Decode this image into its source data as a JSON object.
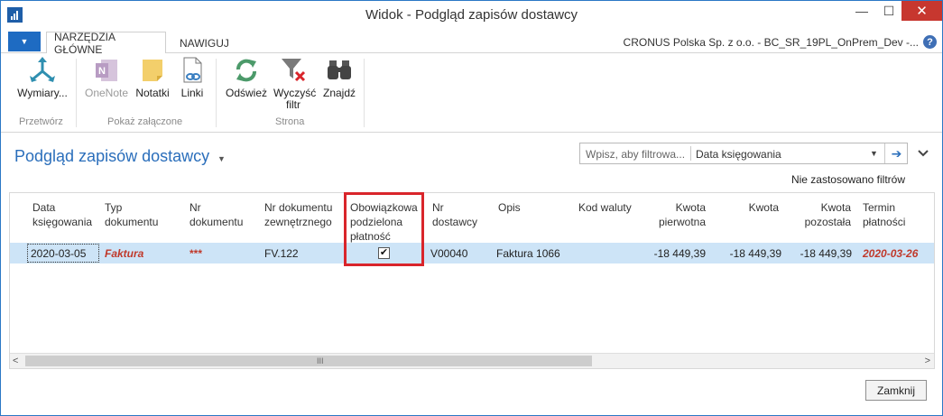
{
  "window": {
    "title": "Widok - Podgląd zapisów dostawcy",
    "minimize_glyph": "—",
    "maximize_glyph": "☐",
    "close_glyph": "✕"
  },
  "ribbon": {
    "tabs": [
      {
        "label": "NARZĘDZIA GŁÓWNE",
        "active": true
      },
      {
        "label": "NAWIGUJ",
        "active": false
      }
    ],
    "company": "CRONUS Polska Sp. z o.o. - BC_SR_19PL_OnPrem_Dev -...",
    "help": "?",
    "menu_glyph": "▼",
    "groups": [
      {
        "label": "Przetwórz",
        "buttons": [
          {
            "label": "Wymiary...",
            "icon": "dimensions-icon"
          }
        ]
      },
      {
        "label": "Pokaż załączone",
        "buttons": [
          {
            "label": "OneNote",
            "icon": "onenote-icon",
            "disabled": true
          },
          {
            "label": "Notatki",
            "icon": "notes-icon"
          },
          {
            "label": "Linki",
            "icon": "links-icon"
          }
        ]
      },
      {
        "label": "Strona",
        "buttons": [
          {
            "label": "Odśwież",
            "icon": "refresh-icon"
          },
          {
            "label": "Wyczyść filtr",
            "icon": "clear-filter-icon"
          },
          {
            "label": "Znajdź",
            "icon": "binoculars-icon"
          }
        ]
      }
    ]
  },
  "page": {
    "title": "Podgląd zapisów dostawcy",
    "filter": {
      "placeholder": "Wpisz, aby filtrowa...",
      "field": "Data księgowania"
    },
    "filter_status": "Nie zastosowano filtrów"
  },
  "grid": {
    "columns": [
      "Data księgowania",
      "Typ dokumentu",
      "Nr dokumentu",
      "Nr dokumentu zewnętrznego",
      "Obowiązkowa podzielona płatność",
      "Nr dostawcy",
      "Opis",
      "Kod waluty",
      "Kwota pierwotna",
      "Kwota",
      "Kwota pozostała",
      "Termin płatności"
    ],
    "rows": [
      {
        "posting_date": "2020-03-05",
        "document_type": "Faktura",
        "document_no": "***",
        "external_document_no": "FV.122",
        "split_payment": true,
        "vendor_no": "V00040",
        "description": "Faktura 1066",
        "currency_code": "",
        "original_amount": "-18 449,39",
        "amount": "-18 449,39",
        "remaining_amount": "-18 449,39",
        "due_date": "2020-03-26"
      }
    ],
    "scroll_grip": "III"
  },
  "footer": {
    "close_label": "Zamknij"
  },
  "colors": {
    "accent": "#2a6ebb",
    "selected_row": "#cde4f7",
    "highlight_border": "#d9252b",
    "overdue_text": "#c0392b"
  }
}
